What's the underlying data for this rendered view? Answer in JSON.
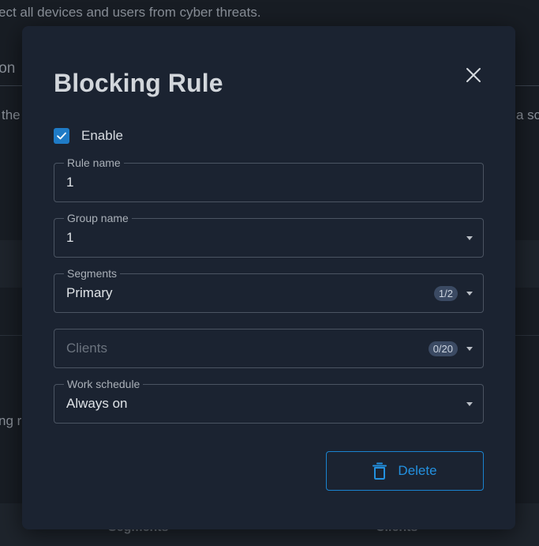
{
  "background": {
    "top_text": "ect all devices and users from cyber threats.",
    "tab_fragment": "ion",
    "left_fragment": "the",
    "right_fragment": "a sc",
    "row_fragment": "ng ru",
    "col_segments": "Segments",
    "col_clients": "Clients"
  },
  "modal": {
    "title": "Blocking Rule",
    "enable": {
      "label": "Enable",
      "checked": true
    },
    "rule_name": {
      "label": "Rule name",
      "value": "1"
    },
    "group_name": {
      "label": "Group name",
      "value": "1"
    },
    "segments": {
      "label": "Segments",
      "value": "Primary",
      "count": "1/2"
    },
    "clients": {
      "placeholder": "Clients",
      "count": "0/20"
    },
    "work_schedule": {
      "label": "Work schedule",
      "value": "Always on"
    },
    "delete_label": "Delete"
  },
  "colors": {
    "accent": "#1f7bc6",
    "modal_bg": "#1b2331",
    "page_bg": "#181d24",
    "delete_text": "#2391e0"
  },
  "icons": [
    "close-icon",
    "check-icon",
    "chevron-down-icon",
    "trash-icon"
  ]
}
